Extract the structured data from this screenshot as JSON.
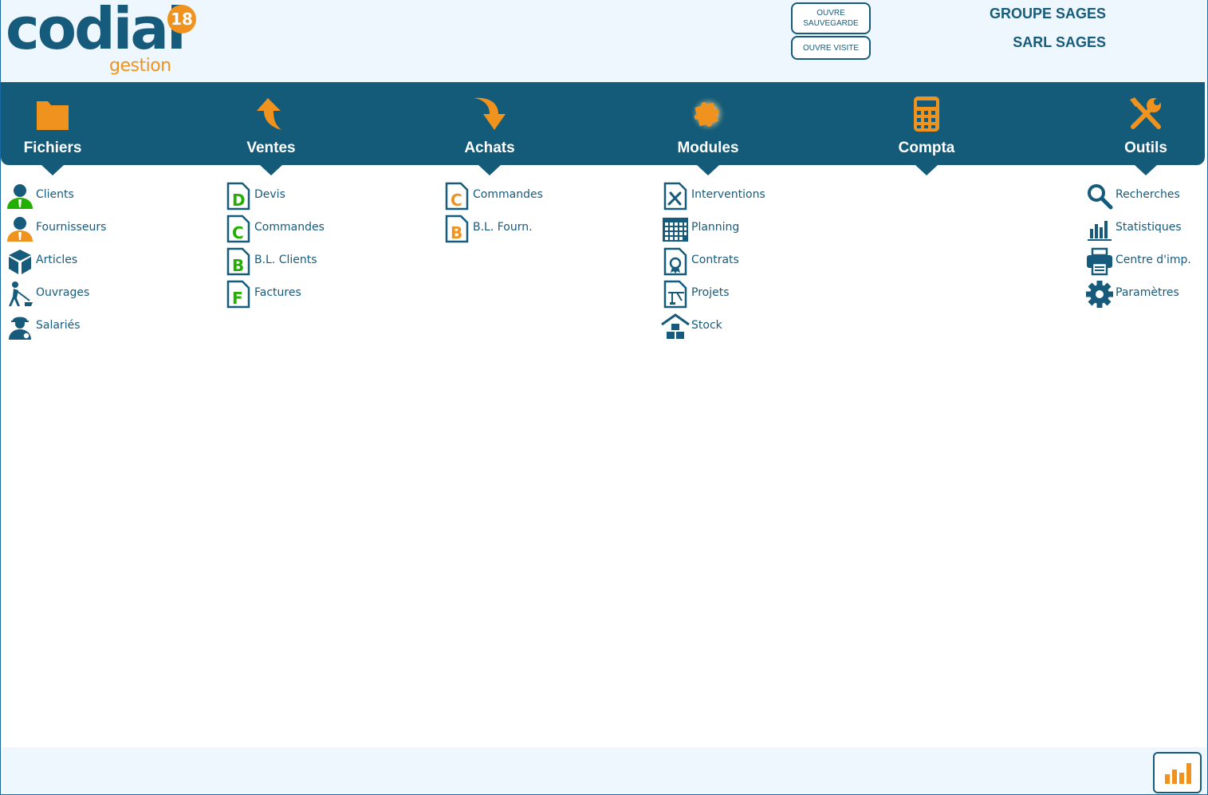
{
  "logo": {
    "word": "codial",
    "sub": "gestion",
    "badge": "18"
  },
  "header": {
    "btn_sauvegarde_line1": "OUVRE",
    "btn_sauvegarde_line2": "SAUVEGARDE",
    "btn_visite": "OUVRE VISITE",
    "company_group": "GROUPE SAGES",
    "company_name": "SARL SAGES"
  },
  "colors": {
    "primary": "#135b78",
    "accent": "#f0921e",
    "text": "#175b7c",
    "header_bg": "#eef7fd",
    "green": "#22b000"
  },
  "nav": [
    {
      "label": "Fichiers",
      "icon": "folder-icon"
    },
    {
      "label": "Ventes",
      "icon": "arrow-up-icon"
    },
    {
      "label": "Achats",
      "icon": "arrow-down-icon"
    },
    {
      "label": "Modules",
      "icon": "puzzle-icon"
    },
    {
      "label": "Compta",
      "icon": "calculator-icon"
    },
    {
      "label": "Outils",
      "icon": "tools-icon"
    }
  ],
  "menus": {
    "fichiers": [
      "Clients",
      "Fournisseurs",
      "Articles",
      "Ouvrages",
      "Salariés"
    ],
    "ventes": [
      "Devis",
      "Commandes",
      "B.L. Clients",
      "Factures"
    ],
    "ventes_letters": [
      "D",
      "C",
      "B",
      "F"
    ],
    "achats": [
      "Commandes",
      "B.L. Fourn."
    ],
    "achats_letters": [
      "C",
      "B"
    ],
    "modules": [
      "Interventions",
      "Planning",
      "Contrats",
      "Projets",
      "Stock"
    ],
    "outils": [
      "Recherches",
      "Statistiques",
      "Centre d'imp.",
      "Paramètres"
    ]
  },
  "footer": {
    "stats_icon": "bar-chart-icon"
  }
}
